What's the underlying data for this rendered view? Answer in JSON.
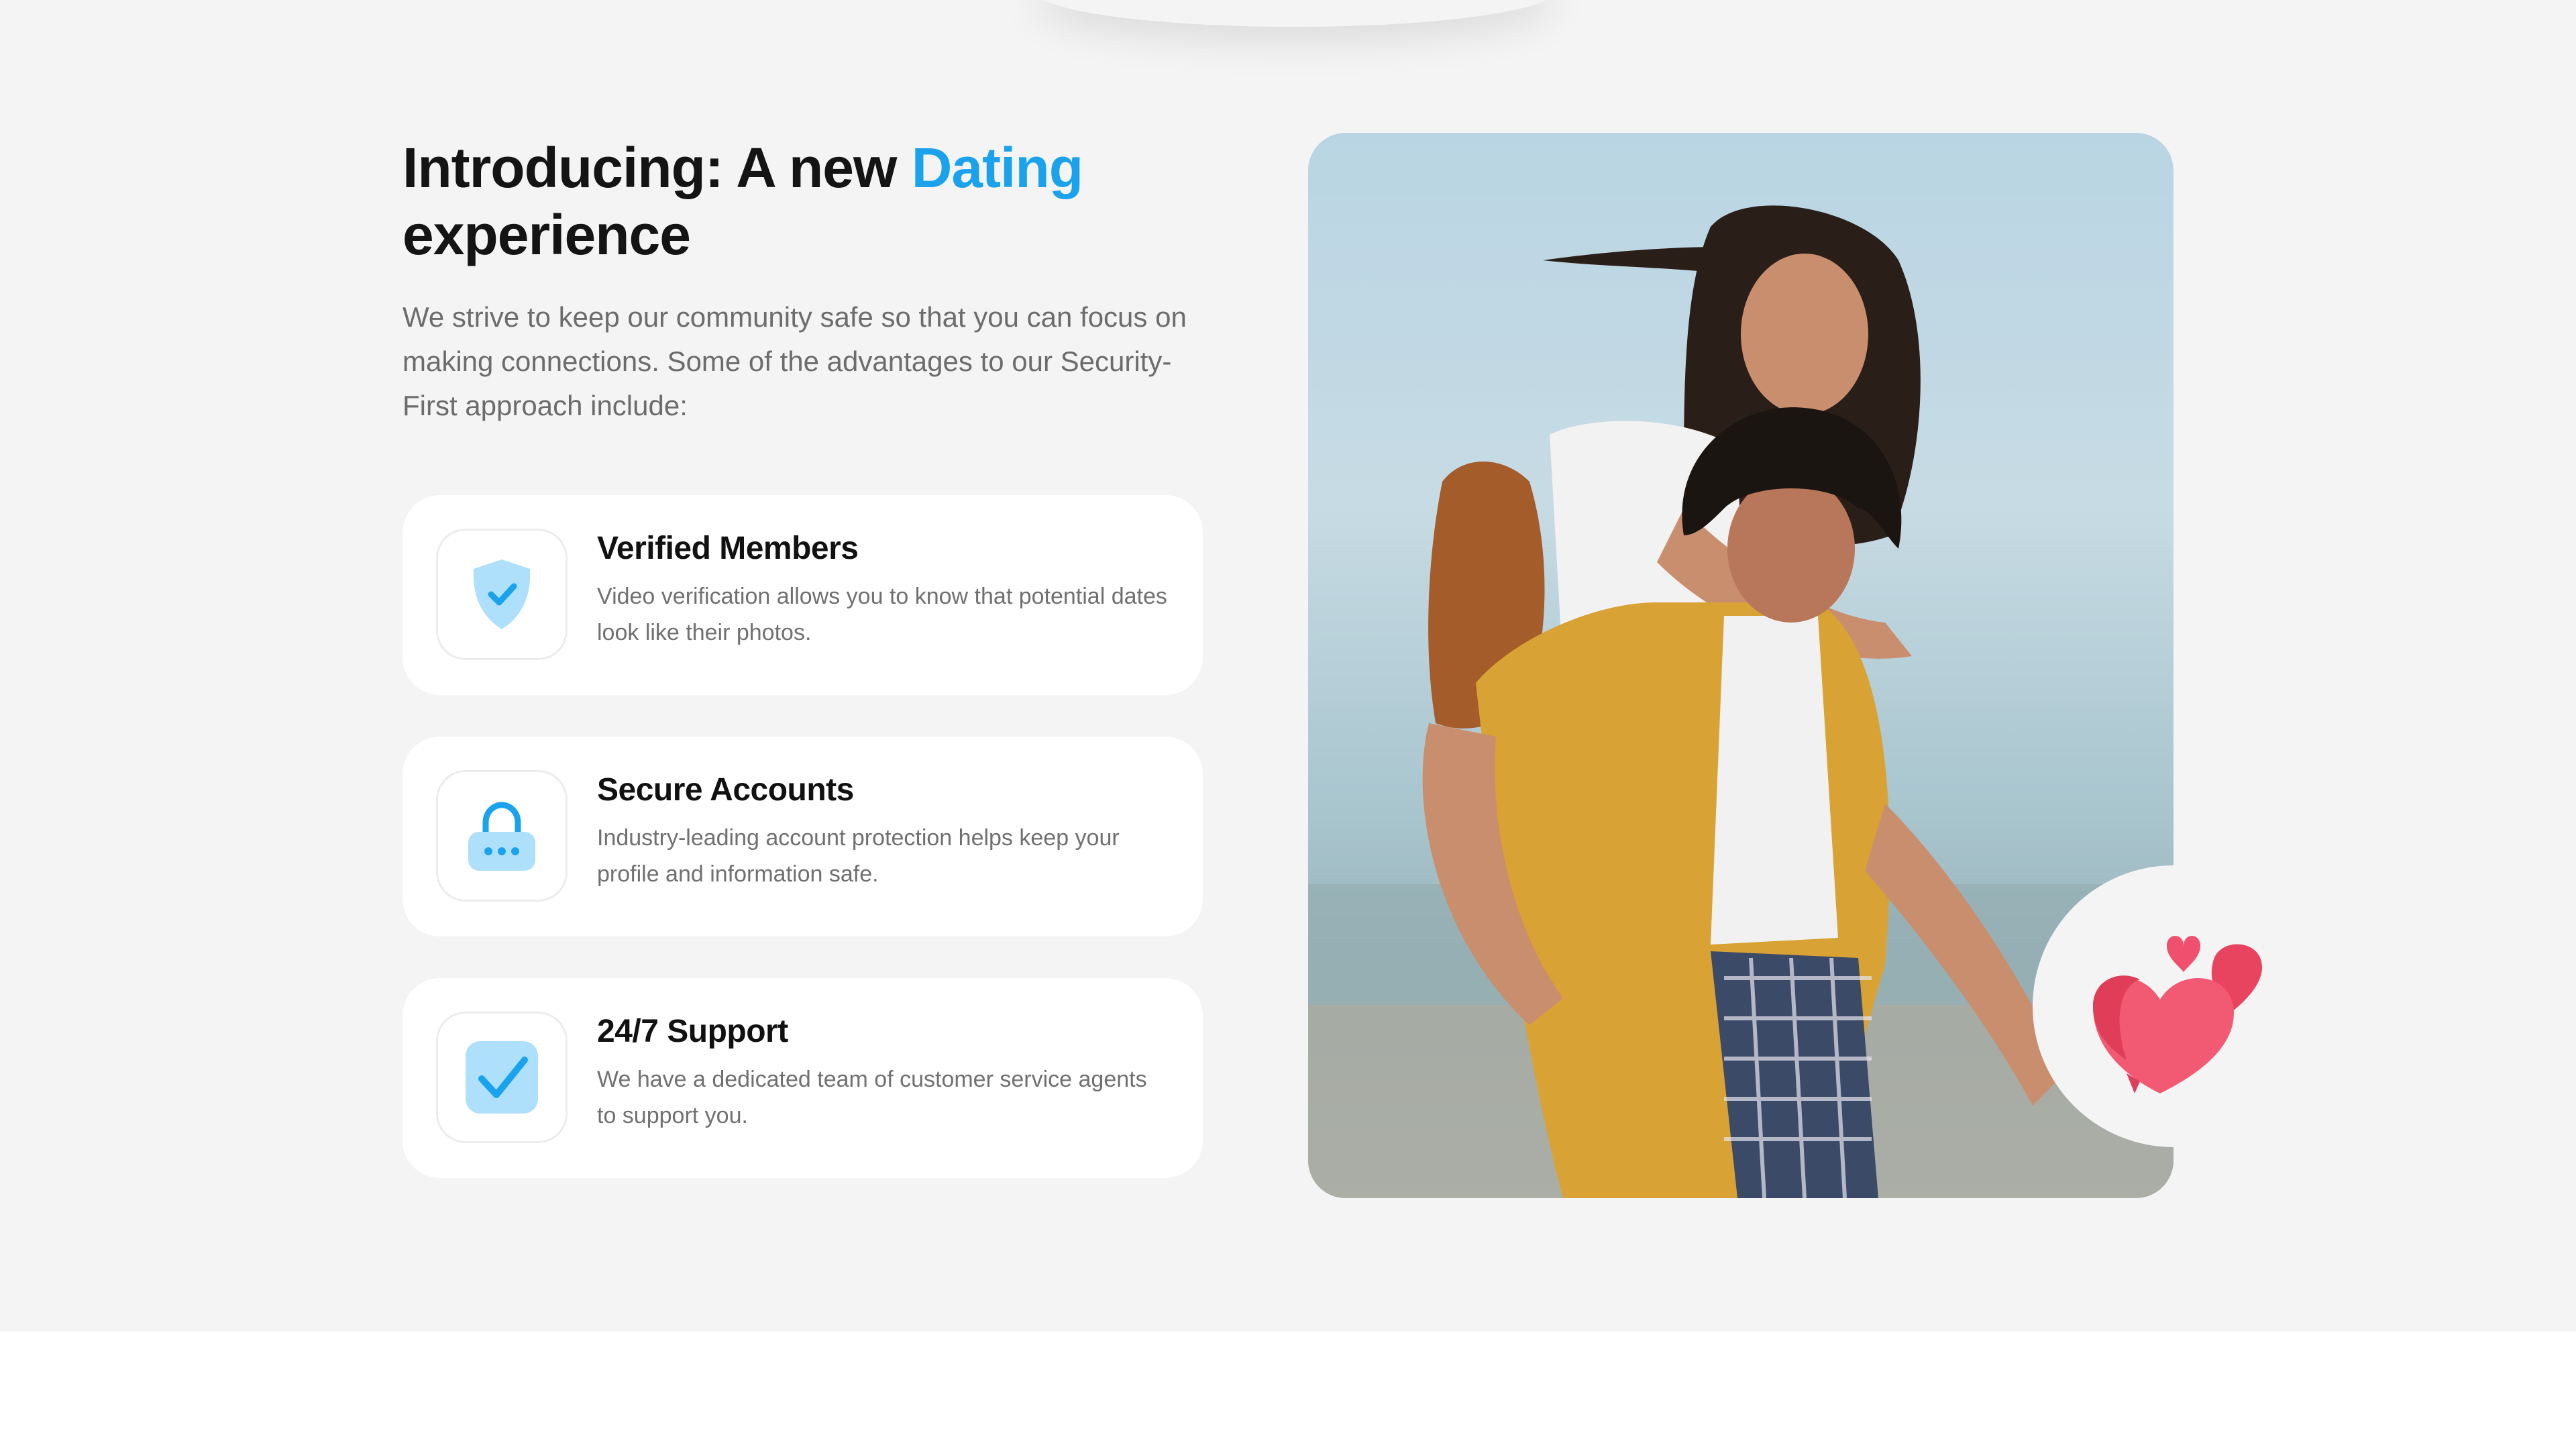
{
  "hero": {
    "title_prefix": "Introducing: A new ",
    "title_accent": "Dating",
    "title_suffix": " experience",
    "description": "We strive to keep our community safe so that you can focus on making connections. Some of the advantages to our Security-First approach include:"
  },
  "features": [
    {
      "icon": "shield-check-icon",
      "title": "Verified Members",
      "text": "Video verification allows you to know that potential dates look like their photos."
    },
    {
      "icon": "padlock-icon",
      "title": "Secure Accounts",
      "text": "Industry-leading account protection helps keep your profile and information safe."
    },
    {
      "icon": "checkbox-icon",
      "title": "24/7 Support",
      "text": "We have a dedicated team of customer service agents to support you."
    }
  ],
  "colors": {
    "accent": "#1aa3ec",
    "icon_fill": "#aee0fb",
    "heart": "#f0506e",
    "section_bg": "#f4f4f4"
  }
}
